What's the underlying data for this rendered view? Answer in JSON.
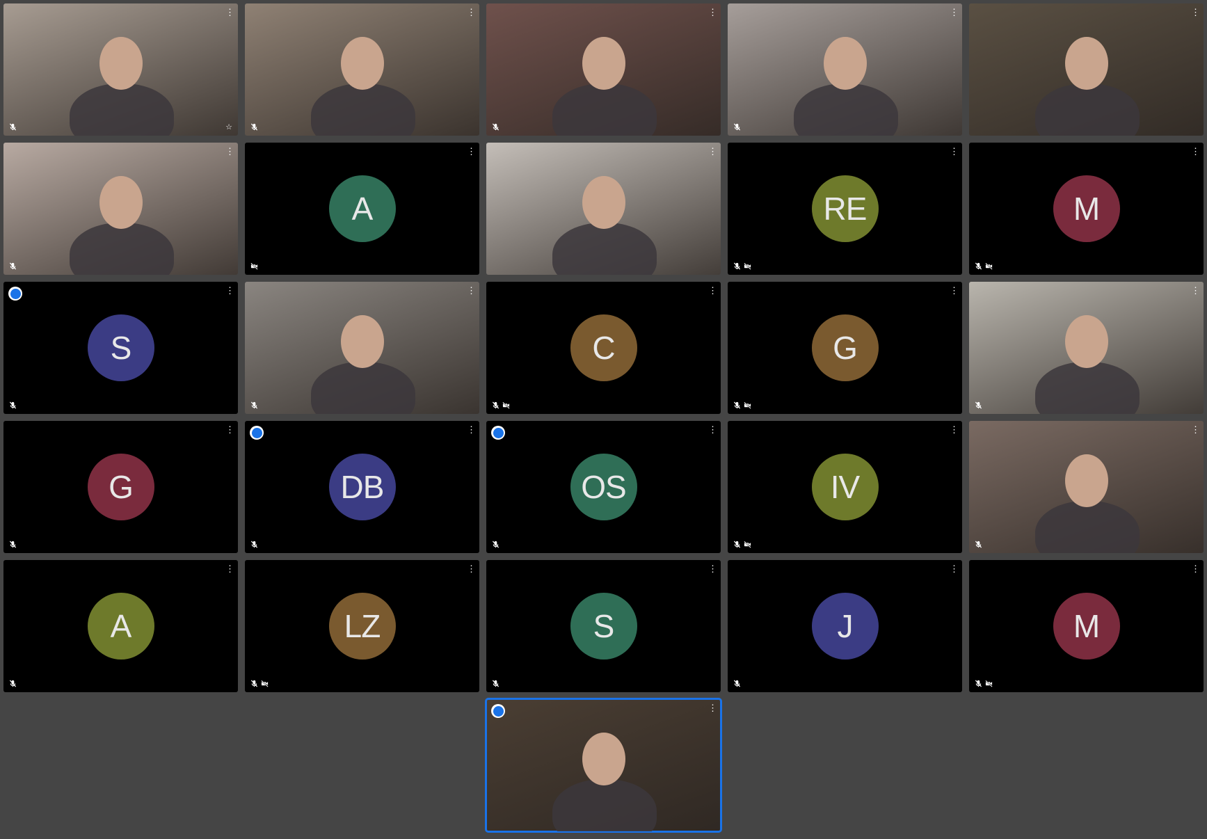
{
  "meeting": {
    "more_options_glyph": "⋮",
    "pin_glyph": "☆",
    "presenting_badge_glyph": "⬤",
    "tiles": [
      {
        "kind": "video",
        "name": "tile-video-1",
        "bg": "#a79c92",
        "mic_off": true,
        "pinned": true
      },
      {
        "kind": "video",
        "name": "tile-video-2",
        "bg": "#8f8174",
        "mic_off": true
      },
      {
        "kind": "video",
        "name": "tile-video-3",
        "bg": "#6f514c",
        "mic_off": true
      },
      {
        "kind": "video",
        "name": "tile-video-4",
        "bg": "#a69e9a",
        "mic_off": true
      },
      {
        "kind": "video",
        "name": "tile-video-5",
        "bg": "#5a5043",
        "mic_off": false
      },
      {
        "kind": "video",
        "name": "tile-video-6",
        "bg": "#b8aaa2",
        "mic_off": true
      },
      {
        "kind": "avatar",
        "initials": "A",
        "color": "#2f6e56",
        "mic_off": false,
        "cam_off": true
      },
      {
        "kind": "video",
        "name": "tile-video-8",
        "bg": "#c4beb8",
        "mic_off": false
      },
      {
        "kind": "avatar",
        "initials": "RE",
        "color": "#6e7a2b",
        "mic_off": true,
        "cam_off": true
      },
      {
        "kind": "avatar",
        "initials": "M",
        "color": "#7a2b3d",
        "mic_off": true,
        "cam_off": true
      },
      {
        "kind": "avatar",
        "initials": "S",
        "color": "#3b3c84",
        "mic_off": true,
        "badge": true
      },
      {
        "kind": "video",
        "name": "tile-video-12",
        "bg": "#8a8580",
        "mic_off": true
      },
      {
        "kind": "avatar",
        "initials": "C",
        "color": "#7a5a2f",
        "mic_off": true,
        "cam_off": true
      },
      {
        "kind": "avatar",
        "initials": "G",
        "color": "#7a5a2f",
        "mic_off": true,
        "cam_off": true
      },
      {
        "kind": "video",
        "name": "tile-video-15",
        "bg": "#b9b5ad",
        "mic_off": true
      },
      {
        "kind": "avatar",
        "initials": "G",
        "color": "#7a2b3d",
        "mic_off": true
      },
      {
        "kind": "avatar",
        "initials": "DB",
        "color": "#3b3c84",
        "mic_off": true,
        "badge": true
      },
      {
        "kind": "avatar",
        "initials": "OS",
        "color": "#2f6e56",
        "mic_off": true,
        "badge": true
      },
      {
        "kind": "avatar",
        "initials": "IV",
        "color": "#6e7a2b",
        "mic_off": true,
        "cam_off": true
      },
      {
        "kind": "video",
        "name": "tile-video-20",
        "bg": "#7a6a62",
        "mic_off": true
      },
      {
        "kind": "avatar",
        "initials": "A",
        "color": "#6e7a2b",
        "mic_off": true
      },
      {
        "kind": "avatar",
        "initials": "LZ",
        "color": "#7a5a2f",
        "mic_off": true,
        "cam_off": true
      },
      {
        "kind": "avatar",
        "initials": "S",
        "color": "#2f6e56",
        "mic_off": true
      },
      {
        "kind": "avatar",
        "initials": "J",
        "color": "#3b3c84",
        "mic_off": true
      },
      {
        "kind": "avatar",
        "initials": "M",
        "color": "#7a2b3d",
        "mic_off": true,
        "cam_off": true
      },
      {
        "kind": "video",
        "name": "tile-video-self",
        "bg": "#4a3e33",
        "mic_off": false,
        "badge": true,
        "active": true
      }
    ]
  }
}
